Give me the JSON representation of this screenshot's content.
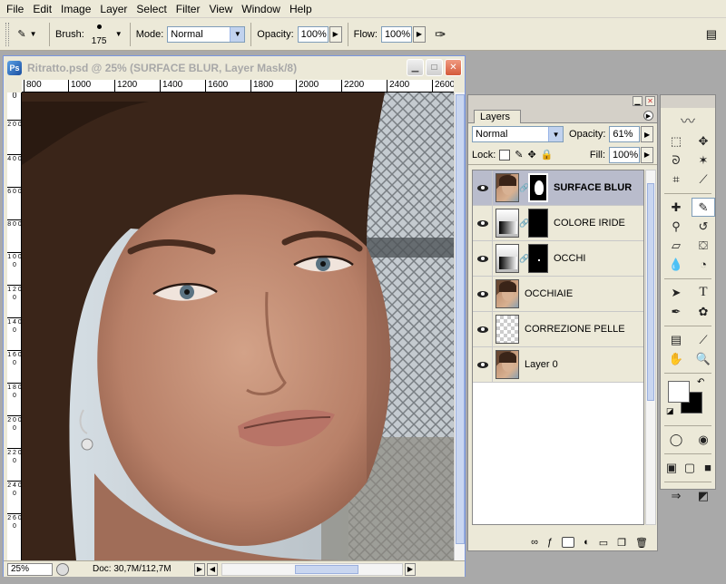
{
  "menubar": [
    "File",
    "Edit",
    "Image",
    "Layer",
    "Select",
    "Filter",
    "View",
    "Window",
    "Help"
  ],
  "options": {
    "brush_label": "Brush:",
    "brush_size": "175",
    "mode_label": "Mode:",
    "mode_value": "Normal",
    "opacity_label": "Opacity:",
    "opacity_value": "100%",
    "flow_label": "Flow:",
    "flow_value": "100%"
  },
  "document": {
    "title": "Ritratto.psd @ 25% (SURFACE BLUR, Layer Mask/8)",
    "zoom": "25%",
    "doc_size": "Doc: 30,7M/112,7M",
    "ruler_h": [
      "800",
      "1000",
      "1200",
      "1400",
      "1600",
      "1800",
      "2000",
      "2200",
      "2400",
      "2600"
    ],
    "ruler_v": [
      "0",
      "2 0 0",
      "4 0 0",
      "6 0 0",
      "8 0 0",
      "1 0 0 0",
      "1 2 0 0",
      "1 4 0 0",
      "1 6 0 0",
      "1 8 0 0",
      "2 0 0 0",
      "2 2 0 0",
      "2 4 0 0",
      "2 6 0 0"
    ]
  },
  "layers_panel": {
    "tab": "Layers",
    "blend_mode": "Normal",
    "opacity_label": "Opacity:",
    "opacity_value": "61%",
    "lock_label": "Lock:",
    "fill_label": "Fill:",
    "fill_value": "100%",
    "layers": [
      {
        "name": "SURFACE BLUR",
        "thumb": "portrait",
        "mask": "face",
        "active": true
      },
      {
        "name": "COLORE IRIDE",
        "thumb": "adjustment",
        "mask": "black",
        "active": false
      },
      {
        "name": "OCCHI",
        "thumb": "adjustment",
        "mask": "dot",
        "active": false
      },
      {
        "name": "OCCHIAIE",
        "thumb": "portrait",
        "mask": null,
        "active": false
      },
      {
        "name": "CORREZIONE PELLE",
        "thumb": "empty",
        "mask": null,
        "active": false
      },
      {
        "name": "Layer 0",
        "thumb": "portrait",
        "mask": null,
        "active": false
      }
    ]
  },
  "colors": {
    "foreground": "#ffffff",
    "background": "#000000"
  }
}
